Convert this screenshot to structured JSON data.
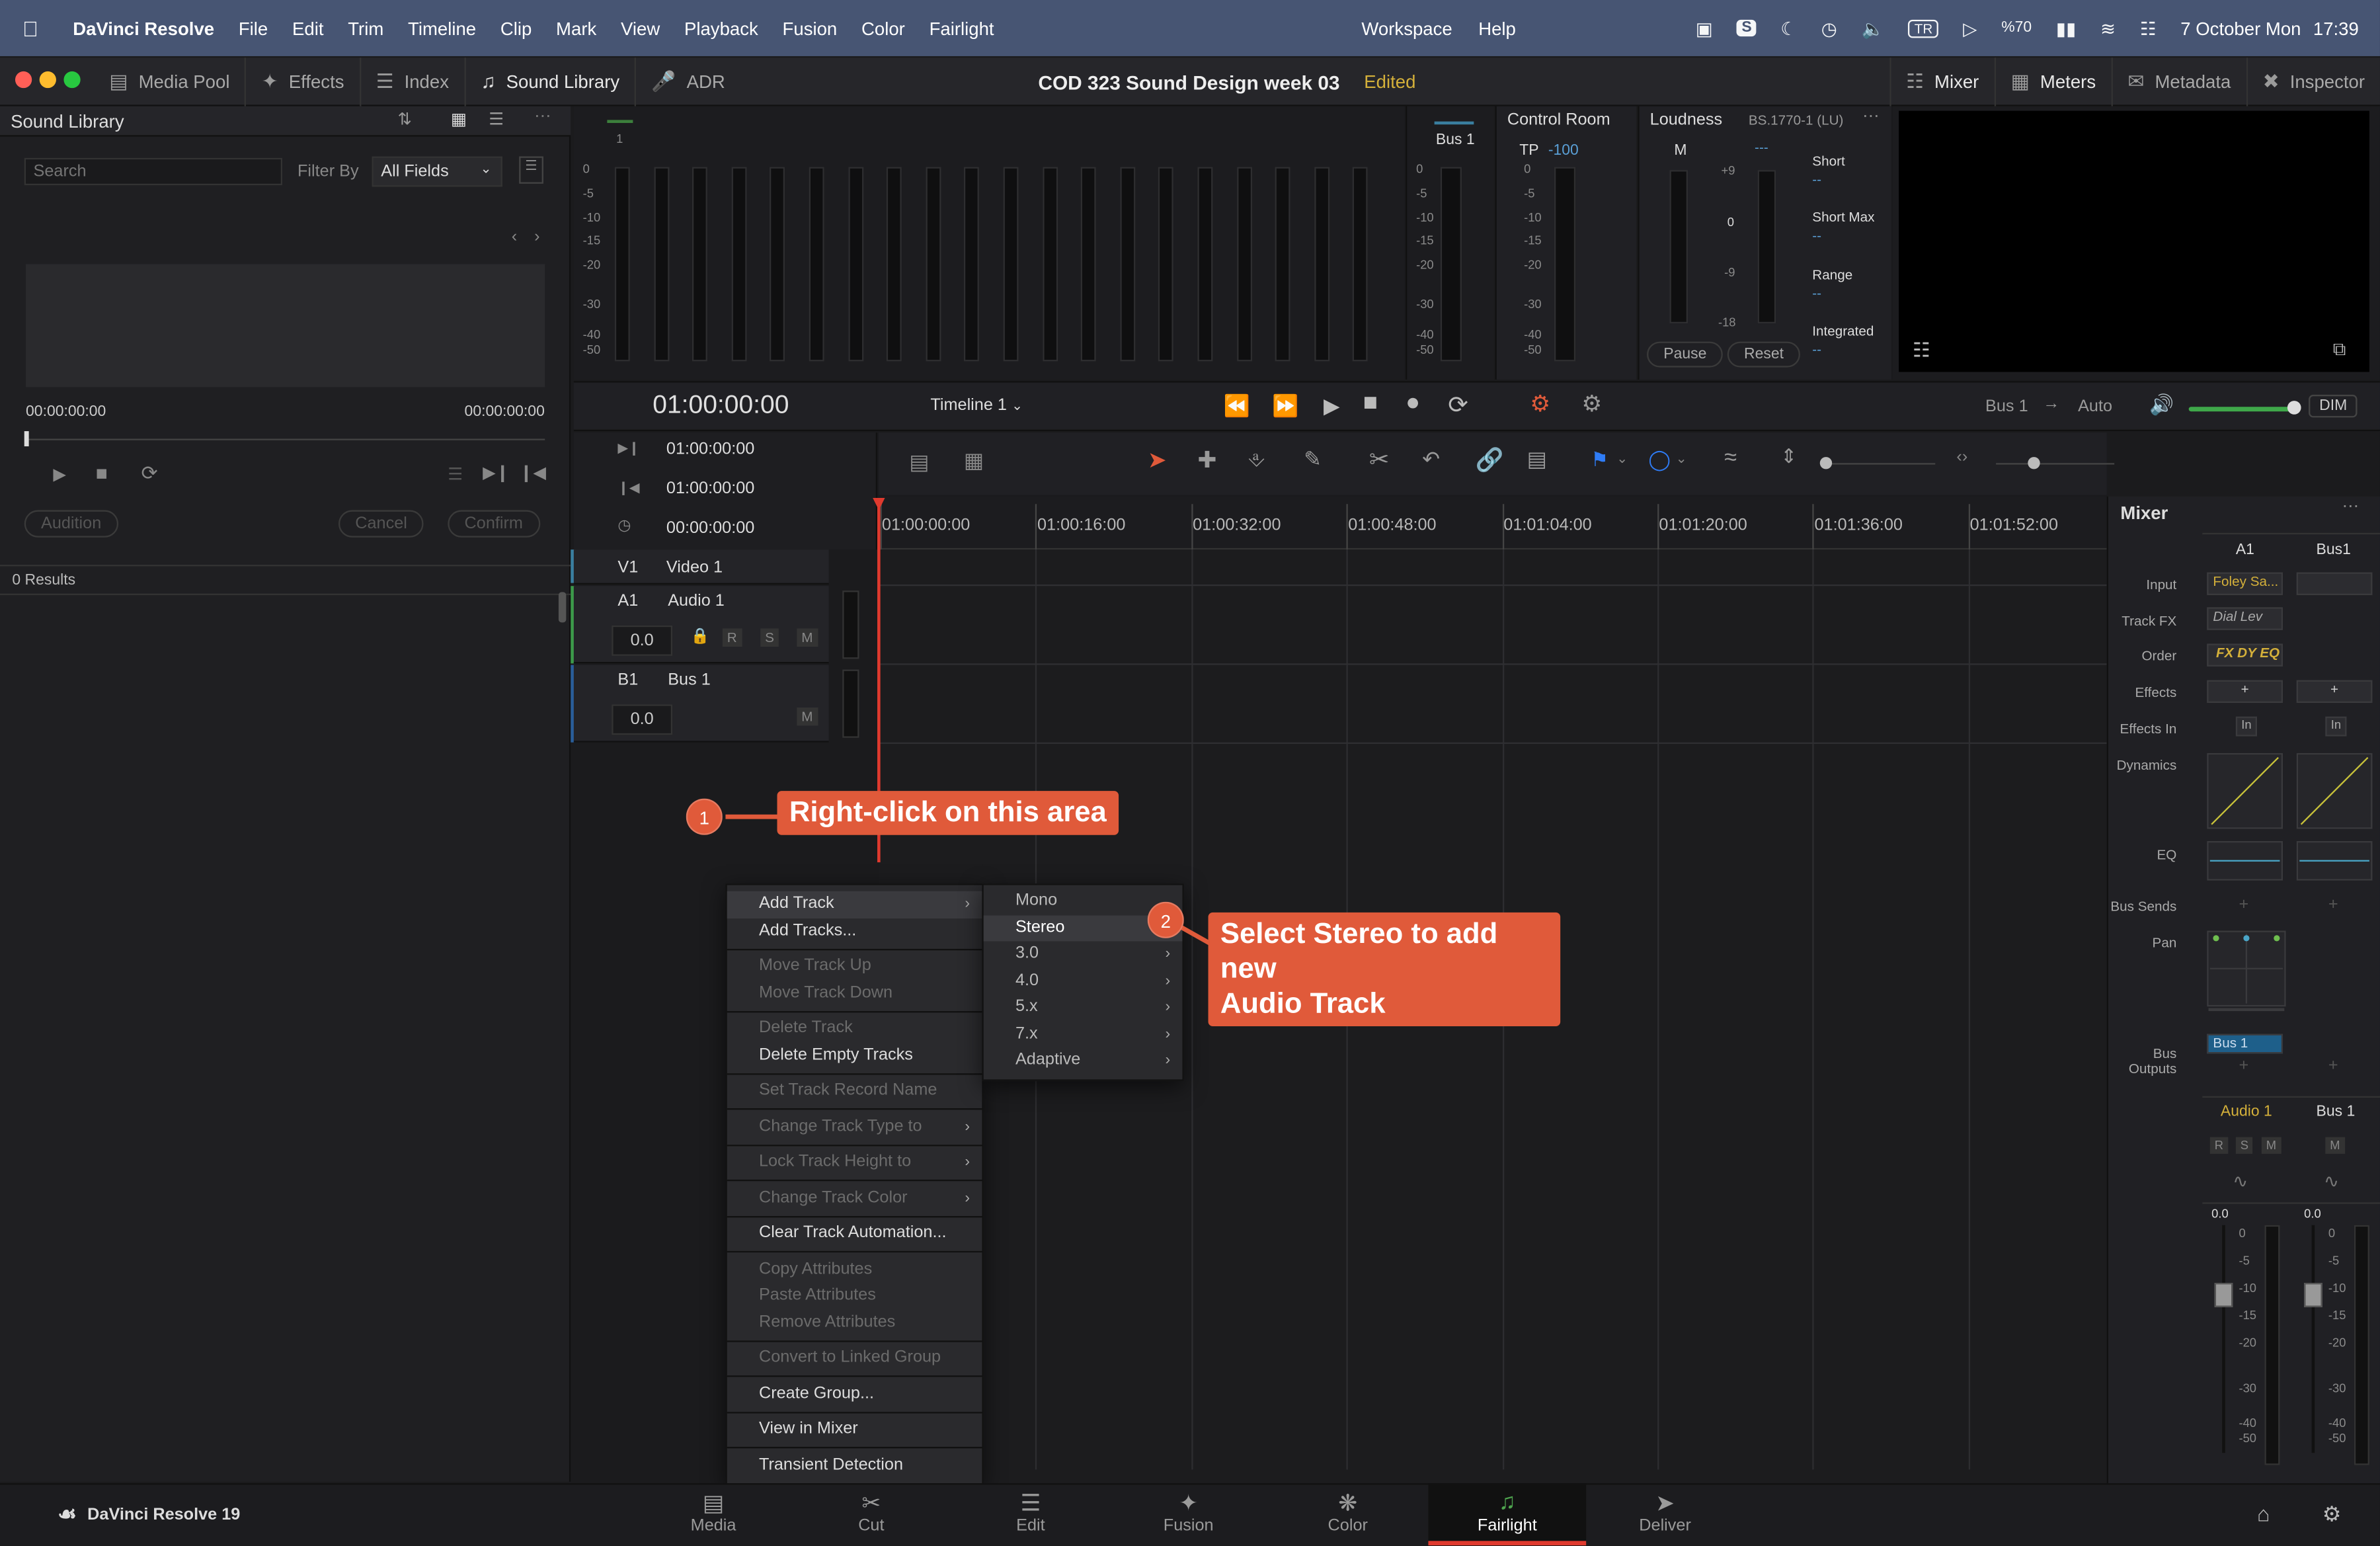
{
  "menubar": {
    "app": "DaVinci Resolve",
    "items": [
      "File",
      "Edit",
      "Trim",
      "Timeline",
      "Clip",
      "Mark",
      "View",
      "Playback",
      "Fusion",
      "Color",
      "Fairlight"
    ],
    "workspace": "Workspace",
    "help": "Help",
    "keyboard": "TR",
    "battery": "%70",
    "date": "7 October Mon",
    "time": "17:39"
  },
  "toolbar": {
    "media_pool": "Media Pool",
    "effects": "Effects",
    "index": "Index",
    "sound_library": "Sound Library",
    "adr": "ADR",
    "project_title": "COD 323 Sound Design week 03",
    "edited": "Edited",
    "mixer": "Mixer",
    "meters": "Meters",
    "metadata": "Metadata",
    "inspector": "Inspector"
  },
  "sound_library": {
    "title": "Sound Library",
    "search_placeholder": "Search",
    "filter_by": "Filter By",
    "filter_value": "All Fields",
    "tc_start": "00:00:00:00",
    "tc_end": "00:00:00:00",
    "audition": "Audition",
    "cancel": "Cancel",
    "confirm": "Confirm",
    "results": "0 Results"
  },
  "meters": {
    "channel": "1",
    "scale": [
      "0",
      "-5",
      "-10",
      "-15",
      "-20",
      "-30",
      "-40",
      "-50"
    ],
    "bus": "Bus 1"
  },
  "control_room": {
    "title": "Control Room",
    "tp": "TP",
    "tp_val": "-100"
  },
  "loudness": {
    "title": "Loudness",
    "standard": "BS.1770-1 (LU)",
    "m": "M",
    "m_dash": "---",
    "scale": [
      "+9",
      "0",
      "-9",
      "-18"
    ],
    "short": "Short",
    "short_max": "Short Max",
    "range": "Range",
    "integrated": "Integrated",
    "dash": "--",
    "pause": "Pause",
    "reset": "Reset"
  },
  "transport": {
    "timecode": "01:00:00:00",
    "timeline": "Timeline 1",
    "bus": "Bus 1",
    "auto": "Auto",
    "dim": "DIM"
  },
  "timeline": {
    "tc_in": "01:00:00:00",
    "tc_out": "01:00:00:00",
    "tc_dur": "00:00:00:00",
    "ruler": [
      "01:00:00:00",
      "01:00:16:00",
      "01:00:32:00",
      "01:00:48:00",
      "01:01:04:00",
      "01:01:20:00",
      "01:01:36:00",
      "01:01:52:00"
    ],
    "tracks": [
      {
        "id": "V1",
        "name": "Video 1"
      },
      {
        "id": "A1",
        "name": "Audio 1",
        "vol": "0.0"
      },
      {
        "id": "B1",
        "name": "Bus 1",
        "vol": "0.0"
      }
    ],
    "r": "R",
    "s": "S",
    "m": "M"
  },
  "context_menu": {
    "items": [
      {
        "label": "Add Track",
        "dis": false,
        "sub": true,
        "hl": true
      },
      {
        "label": "Add Tracks...",
        "dis": false
      },
      {
        "sep": true
      },
      {
        "label": "Move Track Up",
        "dis": true
      },
      {
        "label": "Move Track Down",
        "dis": true
      },
      {
        "sep": true
      },
      {
        "label": "Delete Track",
        "dis": true
      },
      {
        "label": "Delete Empty Tracks",
        "dis": false
      },
      {
        "sep": true
      },
      {
        "label": "Set Track Record Name",
        "dis": true
      },
      {
        "sep": true
      },
      {
        "label": "Change Track Type to",
        "dis": true,
        "sub": true
      },
      {
        "sep": true
      },
      {
        "label": "Lock Track Height to",
        "dis": true,
        "sub": true
      },
      {
        "sep": true
      },
      {
        "label": "Change Track Color",
        "dis": true,
        "sub": true
      },
      {
        "sep": true
      },
      {
        "label": "Clear Track Automation...",
        "dis": false
      },
      {
        "sep": true
      },
      {
        "label": "Copy Attributes",
        "dis": true
      },
      {
        "label": "Paste Attributes",
        "dis": true
      },
      {
        "label": "Remove Attributes",
        "dis": true
      },
      {
        "sep": true
      },
      {
        "label": "Convert to Linked Group",
        "dis": true
      },
      {
        "sep": true
      },
      {
        "label": "Create Group...",
        "dis": false
      },
      {
        "sep": true
      },
      {
        "label": "View in Mixer",
        "dis": false
      },
      {
        "sep": true
      },
      {
        "label": "Transient Detection",
        "dis": false
      }
    ]
  },
  "submenu": {
    "items": [
      {
        "label": "Mono"
      },
      {
        "label": "Stereo",
        "hl": true
      },
      {
        "label": "3.0",
        "sub": true
      },
      {
        "label": "4.0",
        "sub": true
      },
      {
        "label": "5.x",
        "sub": true
      },
      {
        "label": "7.x",
        "sub": true
      },
      {
        "label": "Adaptive",
        "sub": true
      }
    ]
  },
  "callouts": {
    "one_num": "1",
    "one_text": "Right-click on this area",
    "two_num": "2",
    "two_text_l1": "Select Stereo to add new",
    "two_text_l2": "Audio Track"
  },
  "mixer": {
    "title": "Mixer",
    "col_a": "A1",
    "col_b": "Bus1",
    "labels": {
      "input": "Input",
      "track_fx": "Track FX",
      "order": "Order",
      "effects": "Effects",
      "effects_in": "Effects In",
      "dynamics": "Dynamics",
      "eq": "EQ",
      "bus_sends": "Bus Sends",
      "pan": "Pan",
      "bus_outputs": "Bus Outputs"
    },
    "input_a": "Foley Sa...",
    "track_fx_a": "Dial Lev",
    "order_a": "FX DY EQ",
    "plus": "+",
    "in": "In",
    "bus_out_a": "Bus 1",
    "name_a": "Audio 1",
    "name_b": "Bus 1",
    "r": "R",
    "s": "S",
    "m": "M",
    "vol_a": "0.0",
    "vol_b": "0.0",
    "fader_scale": [
      "0",
      "-5",
      "-10",
      "-15",
      "-20",
      "-30",
      "-40",
      "-50"
    ]
  },
  "pages": {
    "brand": "DaVinci Resolve 19",
    "items": [
      "Media",
      "Cut",
      "Edit",
      "Fusion",
      "Color",
      "Fairlight",
      "Deliver"
    ],
    "active": "Fairlight"
  },
  "colors": {
    "accent": "#e05a3a",
    "menubar": "#475573",
    "edited": "#d4b03a",
    "fairlight_green": "#4ea44e"
  }
}
